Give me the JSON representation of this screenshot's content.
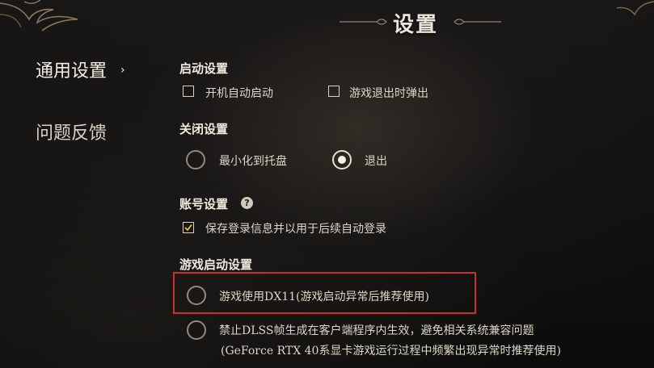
{
  "window": {
    "title": "设置"
  },
  "sidebar": {
    "items": [
      {
        "label": "通用设置",
        "active": true
      },
      {
        "label": "问题反馈",
        "active": false
      }
    ],
    "active_indicator": "›"
  },
  "sections": {
    "startup": {
      "title": "启动设置",
      "options": [
        {
          "label": "开机自动启动",
          "checked": false
        },
        {
          "label": "游戏退出时弹出",
          "checked": false
        }
      ]
    },
    "close": {
      "title": "关闭设置",
      "options": [
        {
          "label": "最小化到托盘",
          "selected": false
        },
        {
          "label": "退出",
          "selected": true
        }
      ]
    },
    "account": {
      "title": "账号设置",
      "help": "?",
      "options": [
        {
          "label": "保存登录信息并以用于后续自动登录",
          "checked": true
        }
      ]
    },
    "game_launch": {
      "title": "游戏启动设置",
      "options": [
        {
          "label": "游戏使用DX11(游戏启动异常后推荐使用)",
          "selected": false,
          "highlighted": true
        },
        {
          "label": "禁止DLSS帧生成在客户端程序内生效，避免相关系统兼容问题",
          "label_line2": "(GeForce RTX 40系显卡游戏运行过程中频繁出现异常时推荐使用)",
          "selected": false
        }
      ]
    }
  },
  "colors": {
    "highlight": "#c9302c",
    "text": "#e8e2d6",
    "background": "#121110"
  },
  "icons": [
    "chevron-right-icon",
    "checkmark-icon",
    "help-icon",
    "corner-ornament-icon"
  ]
}
